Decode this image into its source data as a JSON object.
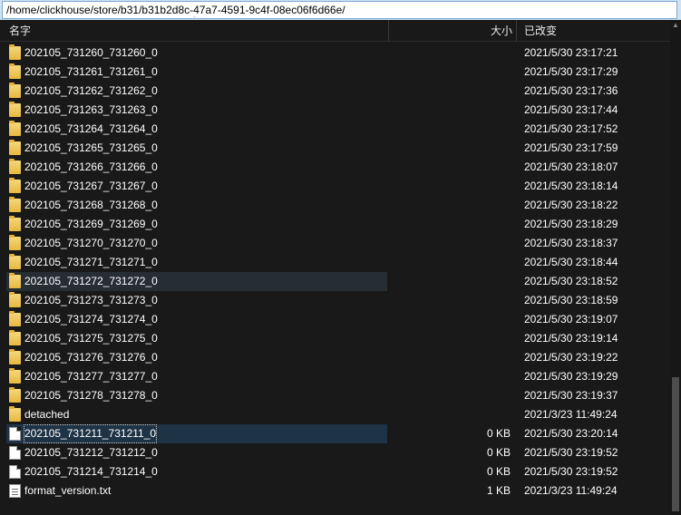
{
  "path": "/home/clickhouse/store/b31/b31b2d8c-47a7-4591-9c4f-08ec06f6d66e/",
  "columns": {
    "name": "名字",
    "size": "大小",
    "date": "已改变"
  },
  "rows": [
    {
      "name": "202105_731260_731260_0",
      "size": "",
      "date": "2021/5/30 23:17:21",
      "type": "folder"
    },
    {
      "name": "202105_731261_731261_0",
      "size": "",
      "date": "2021/5/30 23:17:29",
      "type": "folder"
    },
    {
      "name": "202105_731262_731262_0",
      "size": "",
      "date": "2021/5/30 23:17:36",
      "type": "folder"
    },
    {
      "name": "202105_731263_731263_0",
      "size": "",
      "date": "2021/5/30 23:17:44",
      "type": "folder"
    },
    {
      "name": "202105_731264_731264_0",
      "size": "",
      "date": "2021/5/30 23:17:52",
      "type": "folder"
    },
    {
      "name": "202105_731265_731265_0",
      "size": "",
      "date": "2021/5/30 23:17:59",
      "type": "folder"
    },
    {
      "name": "202105_731266_731266_0",
      "size": "",
      "date": "2021/5/30 23:18:07",
      "type": "folder"
    },
    {
      "name": "202105_731267_731267_0",
      "size": "",
      "date": "2021/5/30 23:18:14",
      "type": "folder"
    },
    {
      "name": "202105_731268_731268_0",
      "size": "",
      "date": "2021/5/30 23:18:22",
      "type": "folder"
    },
    {
      "name": "202105_731269_731269_0",
      "size": "",
      "date": "2021/5/30 23:18:29",
      "type": "folder"
    },
    {
      "name": "202105_731270_731270_0",
      "size": "",
      "date": "2021/5/30 23:18:37",
      "type": "folder"
    },
    {
      "name": "202105_731271_731271_0",
      "size": "",
      "date": "2021/5/30 23:18:44",
      "type": "folder"
    },
    {
      "name": "202105_731272_731272_0",
      "size": "",
      "date": "2021/5/30 23:18:52",
      "type": "folder",
      "state": "hover"
    },
    {
      "name": "202105_731273_731273_0",
      "size": "",
      "date": "2021/5/30 23:18:59",
      "type": "folder"
    },
    {
      "name": "202105_731274_731274_0",
      "size": "",
      "date": "2021/5/30 23:19:07",
      "type": "folder"
    },
    {
      "name": "202105_731275_731275_0",
      "size": "",
      "date": "2021/5/30 23:19:14",
      "type": "folder"
    },
    {
      "name": "202105_731276_731276_0",
      "size": "",
      "date": "2021/5/30 23:19:22",
      "type": "folder"
    },
    {
      "name": "202105_731277_731277_0",
      "size": "",
      "date": "2021/5/30 23:19:29",
      "type": "folder"
    },
    {
      "name": "202105_731278_731278_0",
      "size": "",
      "date": "2021/5/30 23:19:37",
      "type": "folder"
    },
    {
      "name": "detached",
      "size": "",
      "date": "2021/3/23 11:49:24",
      "type": "folder"
    },
    {
      "name": "202105_731211_731211_0",
      "size": "0 KB",
      "date": "2021/5/30 23:20:14",
      "type": "file",
      "state": "selected"
    },
    {
      "name": "202105_731212_731212_0",
      "size": "0 KB",
      "date": "2021/5/30 23:19:52",
      "type": "file"
    },
    {
      "name": "202105_731214_731214_0",
      "size": "0 KB",
      "date": "2021/5/30 23:19:52",
      "type": "file"
    },
    {
      "name": "format_version.txt",
      "size": "1 KB",
      "date": "2021/3/23 11:49:24",
      "type": "text"
    }
  ]
}
